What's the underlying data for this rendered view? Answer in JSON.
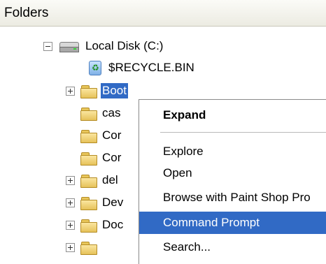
{
  "panel": {
    "title": "Folders"
  },
  "tree": {
    "root": "Local Disk (C:)",
    "items": [
      {
        "label": "$RECYCLE.BIN"
      },
      {
        "label": "Boot"
      },
      {
        "label": "cas"
      },
      {
        "label": "Cor"
      },
      {
        "label": "Cor"
      },
      {
        "label": "del"
      },
      {
        "label": "Dev"
      },
      {
        "label": "Doc"
      }
    ]
  },
  "context_menu": {
    "items": [
      {
        "label": "Expand"
      },
      {
        "label": "Explore"
      },
      {
        "label": "Open"
      },
      {
        "label": "Browse with Paint Shop Pro"
      },
      {
        "label": "Command Prompt"
      },
      {
        "label": "Search..."
      }
    ]
  },
  "colors": {
    "selection": "#316ac5"
  }
}
